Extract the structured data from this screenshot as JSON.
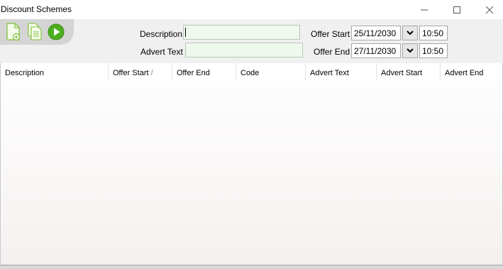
{
  "window": {
    "title": "Discount Schemes",
    "controls": [
      "minimize-icon",
      "maximize-icon",
      "close-icon"
    ]
  },
  "toolbar": {
    "buttons": [
      {
        "name": "new-document-icon",
        "color": "#7cbf3a"
      },
      {
        "name": "copy-document-icon",
        "color": "#7cbf3a"
      },
      {
        "name": "run-play-icon",
        "color": "#4caf1e"
      }
    ]
  },
  "form": {
    "description_label": "Description",
    "description_value": "",
    "advert_text_label": "Advert Text",
    "advert_text_value": "",
    "offer_start_label": "Offer Start",
    "offer_start_date": "25/11/2030",
    "offer_start_time": "10:50",
    "offer_end_label": "Offer End",
    "offer_end_date": "27/11/2030",
    "offer_end_time": "10:50"
  },
  "grid": {
    "columns": [
      "Description",
      "Offer Start",
      "Offer End",
      "Code",
      "Advert Text",
      "Advert Start",
      "Advert End"
    ],
    "sort_indicator": "/",
    "rows": []
  }
}
